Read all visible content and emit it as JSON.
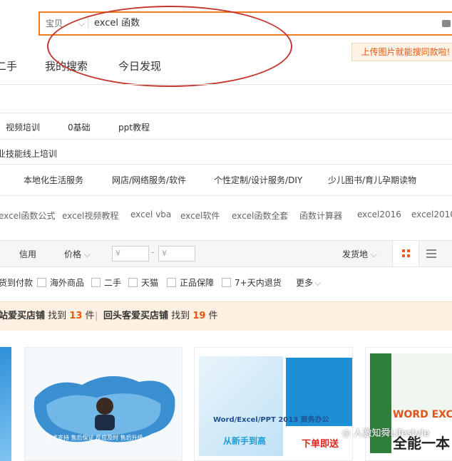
{
  "search": {
    "scope_label": "宝贝",
    "query": "excel 函数",
    "upload_tip": "上传图片就能搜同款啦!"
  },
  "nav": {
    "items": [
      "二手",
      "我的搜索",
      "今日发现"
    ]
  },
  "tags_row1": [
    "视频培训",
    "0基础",
    "ppt教程"
  ],
  "tags_row2": [
    "业技能线上培训"
  ],
  "categories": [
    "本地化生活服务",
    "网店/网络服务/软件",
    "个性定制/设计服务/DIY",
    "少儿图书/育儿孕期读物"
  ],
  "related": [
    "excel函数公式",
    "excel视频教程",
    "excel vba",
    "excel软件",
    "excel函数全套",
    "函数计算器",
    "excel2016",
    "excel2010"
  ],
  "sort": {
    "credit": "信用",
    "price": "价格",
    "price_min_placeholder": "¥",
    "price_dash": "-",
    "price_max_placeholder": "¥",
    "ship_from": "发货地"
  },
  "filters": [
    "货到付款",
    "海外商品",
    "二手",
    "天猫",
    "正品保障",
    "7+天内退货",
    "更多"
  ],
  "stores": {
    "a_label": "站爱买店铺",
    "a_found": "找到",
    "a_count": "13",
    "a_unit": "件",
    "sep": "|",
    "b_label": "回头客爱买店铺",
    "b_found": "找到",
    "b_count": "19",
    "b_unit": "件"
  },
  "products": {
    "card2_caption": "技术支持 售后保证 反应及时 售后升级",
    "card3_title": "Word/Excel/PPT 2013 商务办公",
    "card3_subtitle": "从新手到高",
    "card3_promo": "下单即送",
    "card4_title": "WORD EXCE",
    "card4_subtitle": "全能一本"
  },
  "watermark": "人激知舜Lifestyle",
  "colors": {
    "accent": "#f07a1f",
    "annotation": "#c3362e",
    "highlight": "#e4570e"
  }
}
